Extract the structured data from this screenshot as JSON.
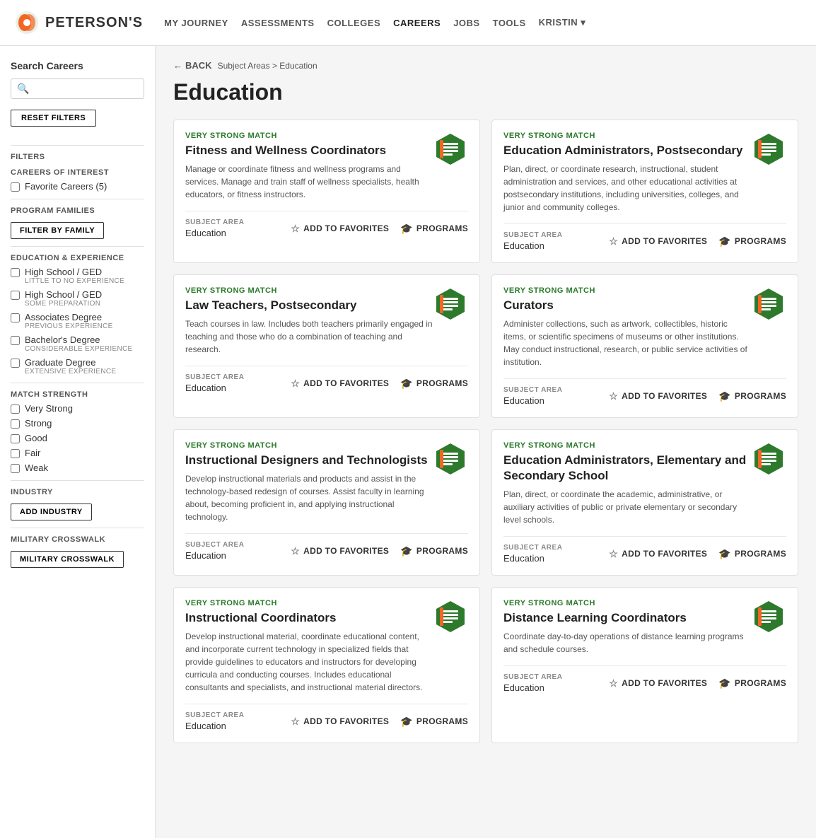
{
  "nav": {
    "logo_text": "PETERSON'S",
    "links": [
      {
        "label": "MY JOURNEY",
        "active": false
      },
      {
        "label": "ASSESSMENTS",
        "active": false
      },
      {
        "label": "COLLEGES",
        "active": false
      },
      {
        "label": "CAREERS",
        "active": true
      },
      {
        "label": "JOBS",
        "active": false
      },
      {
        "label": "TOOLS",
        "active": false
      },
      {
        "label": "KRISTIN ▾",
        "active": false
      }
    ]
  },
  "sidebar": {
    "title": "Search Careers",
    "search_placeholder": "",
    "reset_label": "RESET FILTERS",
    "filters_heading": "Filters",
    "careers_of_interest_heading": "CAREERS OF INTEREST",
    "favorite_careers_label": "Favorite Careers (5)",
    "program_families_heading": "PROGRAM FAMILIES",
    "filter_by_family_label": "FILTER BY FAMILY",
    "education_heading": "EDUCATION & EXPERIENCE",
    "education_items": [
      {
        "label": "High School / GED",
        "sublabel": "LITTLE TO NO EXPERIENCE"
      },
      {
        "label": "High School / GED",
        "sublabel": "SOME PREPARATION"
      },
      {
        "label": "Associates Degree",
        "sublabel": "PREVIOUS EXPERIENCE"
      },
      {
        "label": "Bachelor's Degree",
        "sublabel": "CONSIDERABLE EXPERIENCE"
      },
      {
        "label": "Graduate Degree",
        "sublabel": "EXTENSIVE EXPERIENCE"
      }
    ],
    "match_strength_heading": "MATCH STRENGTH",
    "match_items": [
      {
        "label": "Very Strong"
      },
      {
        "label": "Strong"
      },
      {
        "label": "Good"
      },
      {
        "label": "Fair"
      },
      {
        "label": "Weak"
      }
    ],
    "industry_heading": "INDUSTRY",
    "add_industry_label": "ADD INDUSTRY",
    "military_heading": "MILITARY CROSSWALK",
    "military_label": "MILITARY CROSSWALK"
  },
  "breadcrumb": {
    "back_label": "BACK",
    "path": "Subject Areas > Education"
  },
  "page_title": "Education",
  "cards": [
    {
      "match": "VERY STRONG MATCH",
      "title": "Fitness and Wellness Coordinators",
      "desc": "Manage or coordinate fitness and wellness programs and services. Manage and train staff of wellness specialists, health educators, or fitness instructors.",
      "subject_area_label": "SUBJECT AREA",
      "subject_area": "Education",
      "add_to_favorites": "ADD TO FAVORITES",
      "programs": "PROGRAMS"
    },
    {
      "match": "VERY STRONG MATCH",
      "title": "Education Administrators, Postsecondary",
      "desc": "Plan, direct, or coordinate research, instructional, student administration and services, and other educational activities at postsecondary institutions, including universities, colleges, and junior and community colleges.",
      "subject_area_label": "SUBJECT AREA",
      "subject_area": "Education",
      "add_to_favorites": "ADD TO FAVORITES",
      "programs": "PROGRAMS"
    },
    {
      "match": "VERY STRONG MATCH",
      "title": "Law Teachers, Postsecondary",
      "desc": "Teach courses in law. Includes both teachers primarily engaged in teaching and those who do a combination of teaching and research.",
      "subject_area_label": "SUBJECT AREA",
      "subject_area": "Education",
      "add_to_favorites": "ADD TO FAVORITES",
      "programs": "PROGRAMS"
    },
    {
      "match": "VERY STRONG MATCH",
      "title": "Curators",
      "desc": "Administer collections, such as artwork, collectibles, historic items, or scientific specimens of museums or other institutions. May conduct instructional, research, or public service activities of institution.",
      "subject_area_label": "SUBJECT AREA",
      "subject_area": "Education",
      "add_to_favorites": "ADD TO FAVORITES",
      "programs": "PROGRAMS"
    },
    {
      "match": "VERY STRONG MATCH",
      "title": "Instructional Designers and Technologists",
      "desc": "Develop instructional materials and products and assist in the technology-based redesign of courses. Assist faculty in learning about, becoming proficient in, and applying instructional technology.",
      "subject_area_label": "SUBJECT AREA",
      "subject_area": "Education",
      "add_to_favorites": "ADD TO FAVORITES",
      "programs": "PROGRAMS"
    },
    {
      "match": "VERY STRONG MATCH",
      "title": "Education Administrators, Elementary and Secondary School",
      "desc": "Plan, direct, or coordinate the academic, administrative, or auxiliary activities of public or private elementary or secondary level schools.",
      "subject_area_label": "SUBJECT AREA",
      "subject_area": "Education",
      "add_to_favorites": "ADD TO FAVORITES",
      "programs": "PROGRAMS"
    },
    {
      "match": "VERY STRONG MATCH",
      "title": "Instructional Coordinators",
      "desc": "Develop instructional material, coordinate educational content, and incorporate current technology in specialized fields that provide guidelines to educators and instructors for developing curricula and conducting courses. Includes educational consultants and specialists, and instructional material directors.",
      "subject_area_label": "SUBJECT AREA",
      "subject_area": "Education",
      "add_to_favorites": "ADD TO FAVORITES",
      "programs": "PROGRAMS"
    },
    {
      "match": "VERY STRONG MATCH",
      "title": "Distance Learning Coordinators",
      "desc": "Coordinate day-to-day operations of distance learning programs and schedule courses.",
      "subject_area_label": "SUBJECT AREA",
      "subject_area": "Education",
      "add_to_favorites": "ADD TO FAVORITES",
      "programs": "PROGRAMS"
    }
  ]
}
